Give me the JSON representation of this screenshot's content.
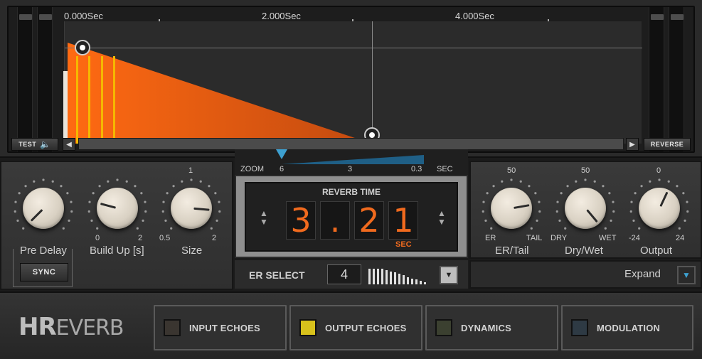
{
  "timeline": {
    "ticks": [
      "0.000Sec",
      "2.000Sec",
      "4.000Sec"
    ],
    "test_label": "TEST",
    "reverse_label": "REVERSE"
  },
  "zoom": {
    "label": "ZOOM",
    "values": [
      "6",
      "3",
      "0.3"
    ],
    "unit": "SEC"
  },
  "reverb_time": {
    "title": "REVERB TIME",
    "digits": [
      "3",
      ".",
      "2",
      "1"
    ],
    "unit": "SEC",
    "seconds": 3.21
  },
  "left_panel": {
    "knobs": [
      {
        "label": "Pre Delay",
        "min": "",
        "max": "",
        "top": ""
      },
      {
        "label": "Build Up [s]",
        "min": "0",
        "max": "2",
        "top": ""
      },
      {
        "label": "Size",
        "min": "0.5",
        "max": "2",
        "top": "1"
      }
    ],
    "sync_label": "SYNC"
  },
  "right_panel": {
    "knobs": [
      {
        "label": "ER/Tail",
        "min": "ER",
        "max": "TAIL",
        "top": "50"
      },
      {
        "label": "Dry/Wet",
        "min": "DRY",
        "max": "WET",
        "top": "50"
      },
      {
        "label": "Output",
        "min": "-24",
        "max": "24",
        "top": "0"
      }
    ]
  },
  "er_select": {
    "label": "ER SELECT",
    "value": "4"
  },
  "expand": {
    "label": "Expand"
  },
  "brand": {
    "logo_hr": "HR",
    "logo_rest": "EVERB"
  },
  "modules": [
    {
      "label": "INPUT ECHOES",
      "led": "#3a3530",
      "on": false
    },
    {
      "label": "OUTPUT ECHOES",
      "led": "#d8c21c",
      "on": true
    },
    {
      "label": "DYNAMICS",
      "led": "#3b4030",
      "on": false
    },
    {
      "label": "MODULATION",
      "led": "#2e3a44",
      "on": false
    }
  ],
  "colors": {
    "accent": "#f06a1e",
    "er_lines": "#f5b800",
    "zoom_marker": "#3da0d0"
  }
}
